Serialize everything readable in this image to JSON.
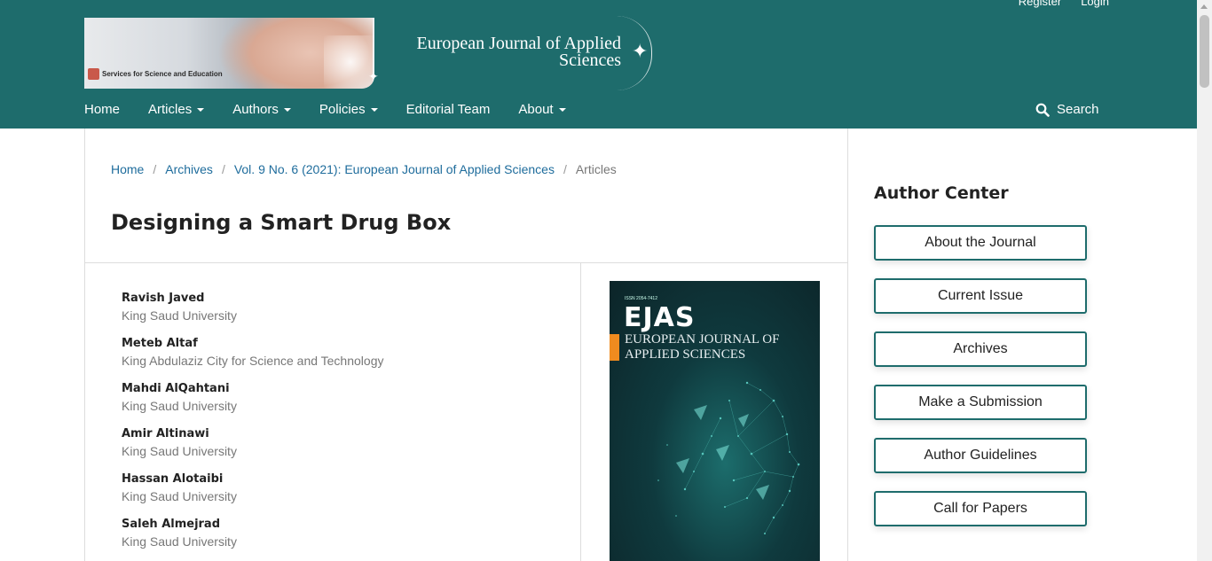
{
  "header": {
    "user_nav": {
      "register": "Register",
      "login": "Login"
    },
    "logo": {
      "badge": "Services for Science and Education",
      "title_line1": "European Journal of Applied",
      "title_line2": "Sciences"
    },
    "nav": [
      {
        "label": "Home",
        "dropdown": false
      },
      {
        "label": "Articles",
        "dropdown": true
      },
      {
        "label": "Authors",
        "dropdown": true
      },
      {
        "label": "Policies",
        "dropdown": true
      },
      {
        "label": "Editorial Team",
        "dropdown": false
      },
      {
        "label": "About",
        "dropdown": true
      }
    ],
    "search_label": "Search",
    "background_color": "#1e6c6c"
  },
  "breadcrumb": {
    "home": "Home",
    "archives": "Archives",
    "issue": "Vol. 9 No. 6 (2021): European Journal of Applied Sciences",
    "current": "Articles",
    "separator": "/"
  },
  "article": {
    "title": "Designing a Smart Drug Box",
    "authors": [
      {
        "name": "Ravish Javed",
        "affiliation": "King Saud University"
      },
      {
        "name": "Meteb Altaf",
        "affiliation": "King Abdulaziz City for Science and Technology"
      },
      {
        "name": "Mahdi AlQahtani",
        "affiliation": "King Saud University"
      },
      {
        "name": "Amir Altinawi",
        "affiliation": "King Saud University"
      },
      {
        "name": "Hassan Alotaibi",
        "affiliation": "King Saud University"
      },
      {
        "name": "Saleh Almejrad",
        "affiliation": "King Saud University"
      }
    ],
    "cover": {
      "issn": "ISSN 2054-7412",
      "acronym": "EJAS",
      "subtitle_line1": "EUROPEAN JOURNAL OF",
      "subtitle_line2": "APPLIED SCIENCES"
    }
  },
  "sidebar": {
    "title": "Author Center",
    "buttons": [
      "About the Journal",
      "Current Issue",
      "Archives",
      "Make a Submission",
      "Author Guidelines",
      "Call for Papers"
    ]
  }
}
